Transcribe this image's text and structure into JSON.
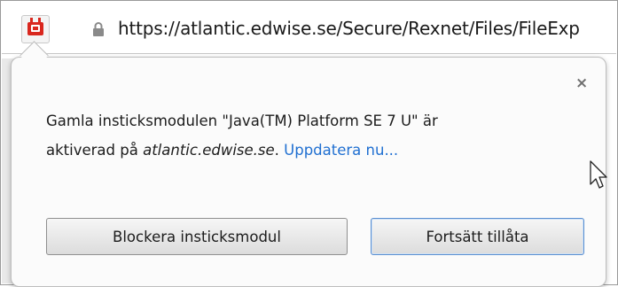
{
  "address_bar": {
    "url": "https://atlantic.edwise.se/Secure/Rexnet/Files/FileExp"
  },
  "popup": {
    "close_label": "×",
    "message_line1": "Gamla insticksmodulen \"Java(TM) Platform SE 7 U\" är",
    "message_prefix": "aktiverad på ",
    "site": "atlantic.edwise.se",
    "message_suffix": ". ",
    "update_link": "Uppdatera nu...",
    "block_button": "Blockera insticksmodul",
    "allow_button": "Fortsätt tillåta"
  },
  "icons": {
    "plugin": "plugin-notification-icon",
    "lock": "lock-icon",
    "cursor": "mouse-pointer-icon"
  },
  "colors": {
    "plugin_icon": "#d9271e",
    "link": "#1f6fd1",
    "focus_border": "#5a8fd0"
  }
}
